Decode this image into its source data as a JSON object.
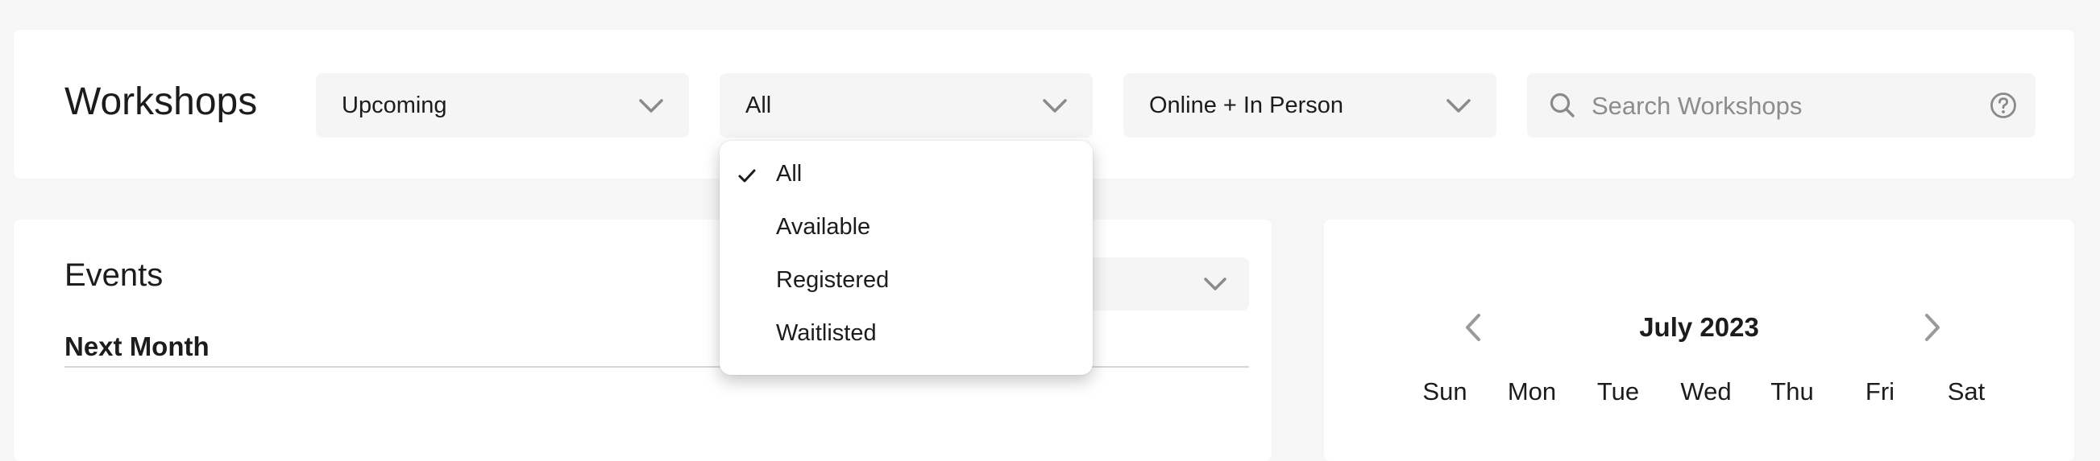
{
  "header": {
    "title": "Workshops",
    "filters": {
      "period": "Upcoming",
      "status": "All",
      "format": "Online + In Person"
    },
    "search": {
      "placeholder": "Search Workshops"
    }
  },
  "status_dropdown": {
    "selected": "All",
    "options": [
      "All",
      "Available",
      "Registered",
      "Waitlisted"
    ]
  },
  "events": {
    "title": "Events",
    "section_label": "Next Month"
  },
  "calendar": {
    "month": "July 2023",
    "weekdays": [
      "Sun",
      "Mon",
      "Tue",
      "Wed",
      "Thu",
      "Fri",
      "Sat"
    ]
  },
  "icons": {
    "chevron": "chevron-down-icon",
    "search": "search-icon",
    "help": "help-icon",
    "check": "check-icon",
    "prev": "chevron-left-icon",
    "next": "chevron-right-icon"
  },
  "colors": {
    "background": "#f6f6f6",
    "card": "#ffffff",
    "control": "#f5f5f5",
    "text": "#1c1c1c",
    "icon": "#8a8a8a"
  }
}
